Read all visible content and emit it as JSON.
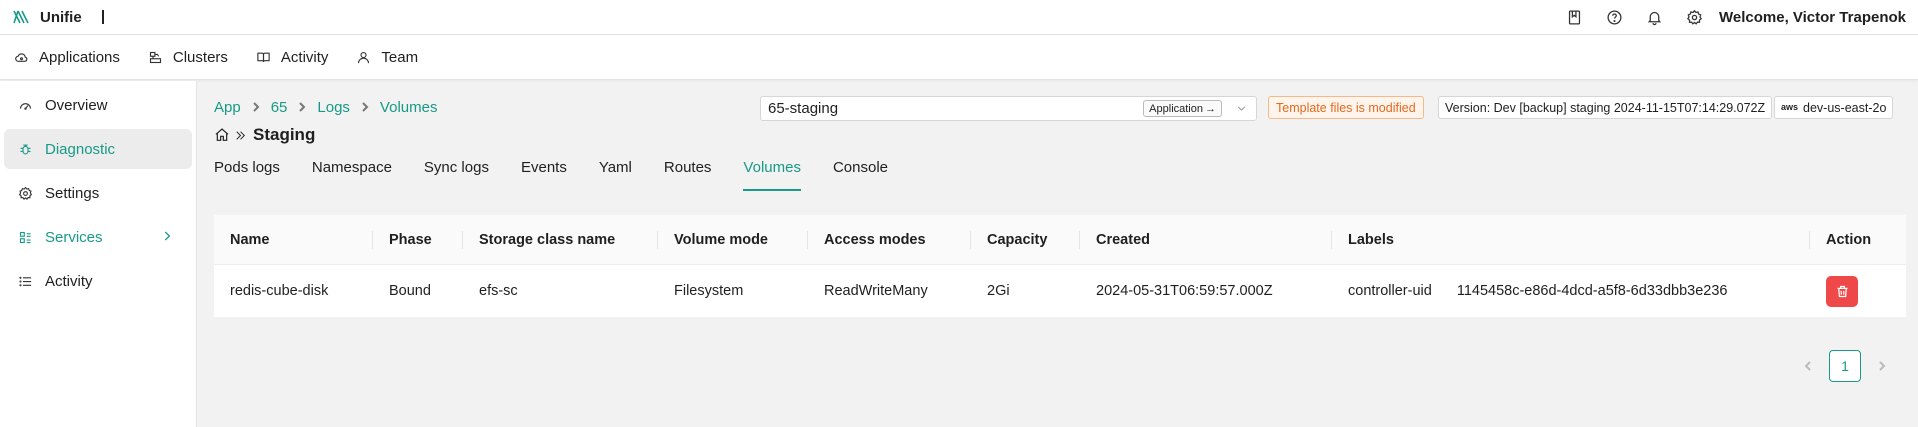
{
  "app": {
    "name": "Unifie",
    "logo_icon": "unifie-logo-icon"
  },
  "topbar": {
    "icons": [
      "book-icon",
      "help-icon",
      "bell-icon",
      "gear-icon"
    ],
    "welcome": "Welcome, Victor Trapenok"
  },
  "nav": {
    "items": [
      {
        "label": "Applications",
        "icon": "cloud-icon"
      },
      {
        "label": "Clusters",
        "icon": "cluster-icon"
      },
      {
        "label": "Activity",
        "icon": "book-open-icon"
      },
      {
        "label": "Team",
        "icon": "user-icon"
      }
    ]
  },
  "sidebar": {
    "items": [
      {
        "label": "Overview",
        "icon": "dashboard-icon"
      },
      {
        "label": "Diagnostic",
        "icon": "bug-icon",
        "active": true
      },
      {
        "label": "Settings",
        "icon": "gear-icon"
      },
      {
        "label": "Services",
        "icon": "services-icon",
        "expandable": true
      },
      {
        "label": "Activity",
        "icon": "list-icon"
      }
    ]
  },
  "breadcrumb": {
    "items": [
      "App",
      "65",
      "Logs",
      "Volumes"
    ]
  },
  "env_select": {
    "value": "65-staging",
    "button_label": "Application",
    "arrow": "→"
  },
  "template_badge": "Template files is modified",
  "version_badge": "Version: Dev [backup] staging 2024-11-15T07:14:29.072Z",
  "region_badge": {
    "provider": "aws",
    "label": "dev-us-east-2o"
  },
  "page_title": "Staging",
  "tabs": {
    "items": [
      "Pods logs",
      "Namespace",
      "Sync logs",
      "Events",
      "Yaml",
      "Routes",
      "Volumes",
      "Console"
    ],
    "active": "Volumes"
  },
  "table": {
    "columns": [
      "Name",
      "Phase",
      "Storage class name",
      "Volume mode",
      "Access modes",
      "Capacity",
      "Created",
      "Labels",
      "Action"
    ],
    "rows": [
      {
        "name": "redis-cube-disk",
        "phase": "Bound",
        "storage_class": "efs-sc",
        "volume_mode": "Filesystem",
        "access_modes": "ReadWriteMany",
        "capacity": "2Gi",
        "created": "2024-05-31T06:59:57.000Z",
        "label_key": "controller-uid",
        "label_value": "1145458c-e86d-4dcd-a5f8-6d33dbb3e236"
      }
    ]
  },
  "pagination": {
    "current_page": "1"
  },
  "colors": {
    "accent": "#179a86",
    "danger": "#ef4848",
    "warning": "#e46a1f"
  }
}
